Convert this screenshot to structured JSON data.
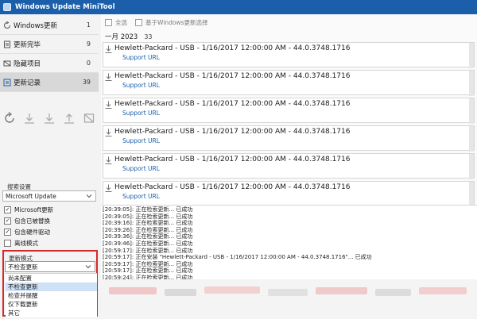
{
  "window": {
    "title": "Windows Update MiniTool"
  },
  "sidebar": {
    "nav": [
      {
        "label": "Windows更新",
        "count": "1",
        "icon": "refresh-icon"
      },
      {
        "label": "更新完毕",
        "count": "9",
        "icon": "document-icon"
      },
      {
        "label": "隐藏项目",
        "count": "0",
        "icon": "hidden-icon"
      },
      {
        "label": "更新记录",
        "count": "39",
        "icon": "history-icon"
      }
    ],
    "toolbar_icons": [
      "refresh-icon",
      "download-icon",
      "download-icon",
      "upload-icon",
      "hide-icon"
    ],
    "search_settings": {
      "label": "搜索设置",
      "source": "Microsoft Update",
      "options": [
        {
          "label": "Microsoft更新",
          "checked": true
        },
        {
          "label": "包含已被替换",
          "checked": true
        },
        {
          "label": "包含硬件驱动",
          "checked": true
        },
        {
          "label": "离线模式",
          "checked": false
        }
      ]
    },
    "update_mode": {
      "label": "更新模式",
      "selected": "不检查更新",
      "options": [
        "尚未配置",
        "不检查更新",
        "检查并提醒",
        "仅下载更新",
        "其它"
      ]
    }
  },
  "main": {
    "toolbar": {
      "select_all": "全选",
      "select_by_windows": "基于Windows更新选择"
    },
    "group": {
      "label": "一月 2023",
      "count": "33"
    },
    "updates": [
      {
        "title": "Hewlett-Packard - USB - 1/16/2017 12:00:00 AM - 44.0.3748.1716",
        "link": "Support URL"
      },
      {
        "title": "Hewlett-Packard - USB - 1/16/2017 12:00:00 AM - 44.0.3748.1716",
        "link": "Support URL"
      },
      {
        "title": "Hewlett-Packard - USB - 1/16/2017 12:00:00 AM - 44.0.3748.1716",
        "link": "Support URL"
      },
      {
        "title": "Hewlett-Packard - USB - 1/16/2017 12:00:00 AM - 44.0.3748.1716",
        "link": "Support URL"
      },
      {
        "title": "Hewlett-Packard - USB - 1/16/2017 12:00:00 AM - 44.0.3748.1716",
        "link": "Support URL"
      },
      {
        "title": "Hewlett-Packard - USB - 1/16/2017 12:00:00 AM - 44.0.3748.1716",
        "link": "Support URL"
      }
    ],
    "log": [
      "[20:39:05]: 正在检索更新... 已成功",
      "[20:39:05]: 正在检索更新... 已成功",
      "[20:39:16]: 正在检索更新... 已成功",
      "[20:39:26]: 正在检索更新... 已成功",
      "[20:39:36]: 正在检索更新... 已成功",
      "[20:39:46]: 正在检索更新... 已成功",
      "[20:59:17]: 正在检索更新... 已成功",
      "[20:59:17]: 正在安装 \"Hewlett-Packard - USB - 1/16/2017 12:00:00 AM - 44.0.3748.1716\"... 已成功",
      "[20:59:17]: 正在检索更新... 已成功",
      "[20:59:17]: 正在检索更新... 已成功",
      "[20:59:24]: 正在检索更新... 已成功"
    ]
  },
  "colors": {
    "accent": "#1b5fab",
    "highlight_border": "#d22b2b",
    "selected_option": "#cfe1f6"
  }
}
